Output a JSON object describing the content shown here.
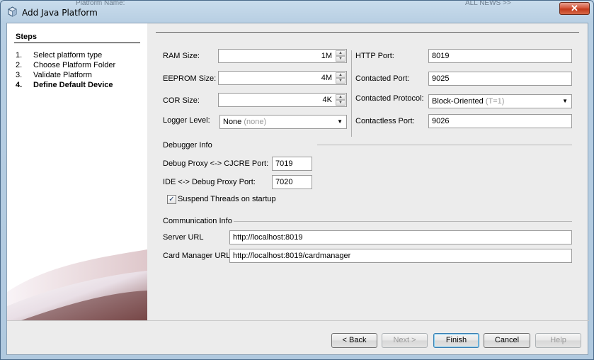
{
  "window": {
    "title": "Add Java Platform",
    "close_label": "✕"
  },
  "background_fragments": {
    "left": "Platform Name:",
    "right": "ALL NEWS >>"
  },
  "steps": {
    "title": "Steps",
    "items": [
      {
        "num": "1.",
        "label": "Select platform type"
      },
      {
        "num": "2.",
        "label": "Choose Platform Folder"
      },
      {
        "num": "3.",
        "label": "Validate Platform"
      },
      {
        "num": "4.",
        "label": "Define Default Device"
      }
    ]
  },
  "memory": {
    "ram_label": "RAM Size:",
    "ram_value": "1M",
    "eeprom_label": "EEPROM Size:",
    "eeprom_value": "4M",
    "cor_label": "COR Size:",
    "cor_value": "4K",
    "logger_label": "Logger Level:",
    "logger_value": "None",
    "logger_hint": "(none)"
  },
  "ports": {
    "http_label": "HTTP Port:",
    "http_value": "8019",
    "contacted_label": "Contacted Port:",
    "contacted_value": "9025",
    "protocol_label": "Contacted Protocol:",
    "protocol_value": "Block-Oriented",
    "protocol_hint": "(T=1)",
    "contactless_label": "Contactless Port:",
    "contactless_value": "9026"
  },
  "debugger": {
    "section_label": "Debugger Info",
    "proxy_label": "Debug Proxy <-> CJCRE Port:",
    "proxy_value": "7019",
    "ide_label": "IDE <-> Debug Proxy Port:",
    "ide_value": "7020",
    "suspend_label": "Suspend Threads on startup",
    "suspend_checked": "✓"
  },
  "communication": {
    "section_label": "Communication Info",
    "server_label": "Server URL",
    "server_value": "http://localhost:8019",
    "card_label": "Card Manager URL",
    "card_value": "http://localhost:8019/cardmanager"
  },
  "buttons": {
    "back": "< Back",
    "next": "Next >",
    "finish": "Finish",
    "cancel": "Cancel",
    "help": "Help"
  },
  "colors": {
    "titlebar": "#b8cfe3",
    "close": "#c23a1c",
    "panel": "#ececec",
    "default_button_border": "#3c7fb1"
  }
}
